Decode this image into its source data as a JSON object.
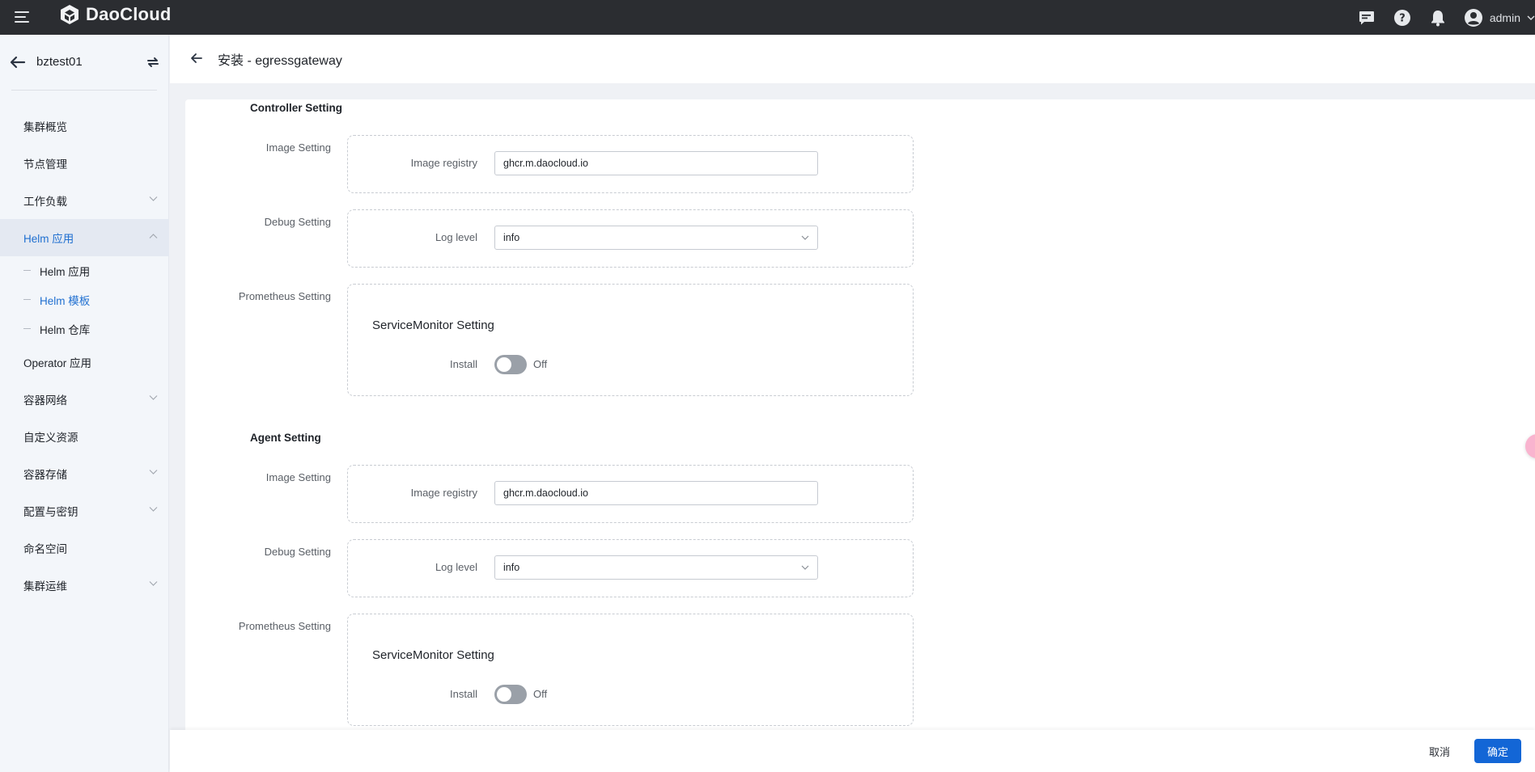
{
  "topbar": {
    "brand": "DaoCloud",
    "user_name": "admin",
    "icons": [
      "menu-icon",
      "chat-icon",
      "help-icon",
      "bell-icon",
      "user-avatar-icon",
      "chevron-down-icon"
    ]
  },
  "sidebar": {
    "cluster_name": "bztest01",
    "items": [
      {
        "label": "集群概览",
        "expandable": false
      },
      {
        "label": "节点管理",
        "expandable": false
      },
      {
        "label": "工作负载",
        "expandable": true
      },
      {
        "label": "Helm 应用",
        "expandable": true,
        "expanded": true,
        "active": true,
        "children": [
          {
            "label": "Helm 应用",
            "active": false
          },
          {
            "label": "Helm 模板",
            "active": true
          },
          {
            "label": "Helm 仓库",
            "active": false
          }
        ]
      },
      {
        "label": "Operator 应用",
        "expandable": false
      },
      {
        "label": "容器网络",
        "expandable": true
      },
      {
        "label": "自定义资源",
        "expandable": false
      },
      {
        "label": "容器存储",
        "expandable": true
      },
      {
        "label": "配置与密钥",
        "expandable": true
      },
      {
        "label": "命名空间",
        "expandable": false
      },
      {
        "label": "集群运维",
        "expandable": true
      }
    ]
  },
  "page": {
    "title": "安装 - egressgateway"
  },
  "form": {
    "controller": {
      "title": "Controller Setting",
      "image_setting_label": "Image Setting",
      "image_registry_label": "Image registry",
      "image_registry_value": "ghcr.m.daocloud.io",
      "debug_setting_label": "Debug Setting",
      "log_level_label": "Log level",
      "log_level_value": "info",
      "prometheus_setting_label": "Prometheus Setting",
      "service_monitor_title": "ServiceMonitor Setting",
      "install_label": "Install",
      "install_state": "Off"
    },
    "agent": {
      "title": "Agent Setting",
      "image_setting_label": "Image Setting",
      "image_registry_label": "Image registry",
      "image_registry_value": "ghcr.m.daocloud.io",
      "debug_setting_label": "Debug Setting",
      "log_level_label": "Log level",
      "log_level_value": "info",
      "prometheus_setting_label": "Prometheus Setting",
      "service_monitor_title": "ServiceMonitor Setting",
      "install_label": "Install",
      "install_state": "Off"
    }
  },
  "footer": {
    "cancel_label": "取消",
    "ok_label": "确定",
    "accent_color": "#1366d6"
  }
}
